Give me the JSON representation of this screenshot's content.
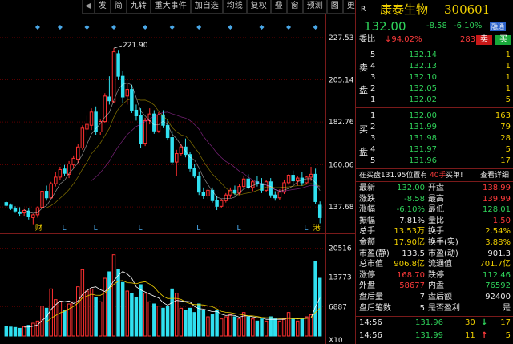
{
  "toolbar": {
    "items": [
      "发",
      "简",
      "九转",
      "重大事件",
      "加自选",
      "均线",
      "复权",
      "叠",
      "窗",
      "预测",
      "图",
      "更多"
    ],
    "arrow_left": "◀",
    "arrow_right": "▶"
  },
  "chart_data": {
    "type": "candlestick",
    "price_axis": {
      "ticks": [
        "227.53",
        "205.14",
        "182.76",
        "160.06",
        "137.68"
      ],
      "tick_values": [
        227.53,
        205.14,
        182.76,
        160.06,
        137.68
      ],
      "range": [
        127.5,
        236.0
      ]
    },
    "volume_axis": {
      "ticks": [
        "20516",
        "13773",
        "6887",
        "X10"
      ],
      "tick_values": [
        20516,
        13773,
        6887
      ],
      "range": [
        0,
        22500
      ]
    },
    "max_annotation": "221.90",
    "event_markers": [
      "财",
      "L",
      "L",
      "L",
      "L",
      "L",
      "L",
      "港"
    ],
    "colors": {
      "up": "#ff3030",
      "down": "#30e0f0",
      "ma1": "#ffffff",
      "ma2": "#f0d000",
      "ma3": "#e040e0",
      "grid": "#5a0000",
      "axis_text": "#e8e8e8"
    },
    "candles": [
      [
        140,
        140.5,
        138,
        138.5
      ],
      [
        138.6,
        139.5,
        136,
        136.8
      ],
      [
        136.7,
        138,
        134.5,
        135.5
      ],
      [
        135,
        137.5,
        133,
        134.2
      ],
      [
        134.5,
        136.5,
        133,
        135.8
      ],
      [
        135.5,
        137,
        131,
        132.5
      ],
      [
        132,
        134,
        128.5,
        133.5
      ],
      [
        133.5,
        138,
        132,
        137.2
      ],
      [
        137.5,
        147,
        136,
        146
      ],
      [
        146,
        149,
        141,
        142.5
      ],
      [
        142.5,
        151,
        142,
        150
      ],
      [
        150,
        156,
        148.5,
        153.5
      ],
      [
        153.5,
        159,
        152,
        157.5
      ],
      [
        157.8,
        160,
        154,
        155.5
      ],
      [
        155,
        162,
        153,
        160.5
      ],
      [
        160,
        165,
        158.5,
        163.5
      ],
      [
        163,
        171,
        161,
        169.5
      ],
      [
        169,
        181,
        168,
        179.5
      ],
      [
        179,
        186,
        175,
        181.5
      ],
      [
        181,
        190,
        178.5,
        188
      ],
      [
        188,
        191,
        176,
        177.5
      ],
      [
        177.5,
        184,
        176,
        183
      ],
      [
        183,
        198,
        182,
        196.5
      ],
      [
        196,
        207,
        192,
        194
      ],
      [
        193.5,
        221.9,
        193,
        220
      ],
      [
        219,
        221,
        205,
        207
      ],
      [
        207,
        210,
        193,
        196
      ],
      [
        196.5,
        203,
        192,
        200
      ],
      [
        200,
        202.5,
        187.5,
        189
      ],
      [
        189,
        192,
        183.5,
        186
      ],
      [
        186,
        190,
        169,
        171.5
      ],
      [
        171.5,
        185,
        170,
        183.5
      ],
      [
        183.5,
        190,
        181.5,
        187
      ],
      [
        187,
        189,
        176.5,
        178
      ],
      [
        178,
        188,
        177,
        186.5
      ],
      [
        186.5,
        189,
        179.5,
        181
      ],
      [
        181,
        184,
        173,
        174.5
      ],
      [
        174.5,
        178,
        160,
        161.5
      ],
      [
        161.5,
        168,
        154,
        166
      ],
      [
        166,
        171,
        165,
        169.5
      ],
      [
        169.5,
        174,
        164,
        165.5
      ],
      [
        165.5,
        167,
        156.5,
        158
      ],
      [
        158,
        160.5,
        153,
        154
      ],
      [
        154,
        156.5,
        144,
        145.5
      ],
      [
        145.5,
        148,
        142,
        143.5
      ],
      [
        143.5,
        148,
        142,
        146.5
      ],
      [
        146.5,
        148,
        140,
        141
      ],
      [
        141,
        143.5,
        136,
        138
      ],
      [
        138,
        142,
        137,
        141
      ],
      [
        141,
        145,
        140,
        144
      ],
      [
        144,
        148,
        142.5,
        146.5
      ],
      [
        146.5,
        149,
        144,
        145
      ],
      [
        145,
        150,
        144,
        148.5
      ],
      [
        148.5,
        154,
        147.5,
        152.5
      ],
      [
        152.5,
        155,
        147,
        148
      ],
      [
        148,
        152,
        146,
        151
      ],
      [
        151,
        154,
        148.5,
        150
      ],
      [
        150,
        153,
        145,
        146.5
      ],
      [
        146.5,
        152,
        145.5,
        151
      ],
      [
        151,
        153,
        142.5,
        144
      ],
      [
        144,
        146,
        141,
        142.5
      ],
      [
        142.5,
        147,
        141.5,
        145.5
      ],
      [
        145.5,
        152,
        144.5,
        150.5
      ],
      [
        150.5,
        155,
        149.5,
        154.5
      ],
      [
        154.5,
        157,
        150,
        151.5
      ],
      [
        151.5,
        154,
        149,
        153
      ],
      [
        153,
        156,
        149,
        150.5
      ],
      [
        150.5,
        154,
        150,
        153.5
      ],
      [
        153.5,
        159,
        151.5,
        155
      ],
      [
        155,
        158,
        139,
        140.5
      ],
      [
        138.6,
        140.6,
        129,
        132
      ]
    ],
    "volumes": [
      2.3,
      2.1,
      2.0,
      1.8,
      2.2,
      2.5,
      3.0,
      3.5,
      7.0,
      6.5,
      11.0,
      8.5,
      8.0,
      6.0,
      7.5,
      8.0,
      11.5,
      15.5,
      10.5,
      11.0,
      9.0,
      8.0,
      13.5,
      15.0,
      19.0,
      15.5,
      12.5,
      10.5,
      10.0,
      9.0,
      12.0,
      10.0,
      8.0,
      7.5,
      7.0,
      6.5,
      7.0,
      11.0,
      10.0,
      6.5,
      6.0,
      6.5,
      5.5,
      7.5,
      6.0,
      4.5,
      5.0,
      6.0,
      4.0,
      4.5,
      5.0,
      4.5,
      4.0,
      5.5,
      4.5,
      4.0,
      3.5,
      4.0,
      3.5,
      4.5,
      4.0,
      3.5,
      4.0,
      5.5,
      4.0,
      3.5,
      4.0,
      4.5,
      5.0,
      17.5,
      13.5
    ],
    "event_marker_positions": [
      {
        "label": "财",
        "index": 7
      },
      {
        "label": "L",
        "index": 13
      },
      {
        "label": "L",
        "index": 20
      },
      {
        "label": "L",
        "index": 30
      },
      {
        "label": "L",
        "index": 43
      },
      {
        "label": "L",
        "index": 52
      },
      {
        "label": "L",
        "index": 67
      },
      {
        "label": "港",
        "index": 69
      }
    ],
    "diamond_indices": [
      7,
      12,
      18,
      24,
      31,
      37,
      43,
      50,
      57,
      63,
      69
    ]
  },
  "panel": {
    "flag": "R",
    "name": "康泰生物",
    "code": "300601",
    "price": "132.00",
    "change": "-8.58",
    "change_pct": "-6.10%",
    "tag": "融通",
    "weibi_label": "委比",
    "weibi_value": "↓94.02%",
    "weibi_num": "283",
    "sell_btn": "卖",
    "buy_btn": "买",
    "sell_side_label": [
      "卖",
      "盘"
    ],
    "buy_side_label": [
      "买",
      "盘"
    ],
    "asks": [
      {
        "lvl": "5",
        "price": "132.14",
        "vol": "1"
      },
      {
        "lvl": "4",
        "price": "132.13",
        "vol": "1"
      },
      {
        "lvl": "3",
        "price": "132.10",
        "vol": "1"
      },
      {
        "lvl": "2",
        "price": "132.05",
        "vol": "1"
      },
      {
        "lvl": "1",
        "price": "132.02",
        "vol": "5"
      }
    ],
    "bids": [
      {
        "lvl": "1",
        "price": "132.00",
        "vol": "163"
      },
      {
        "lvl": "2",
        "price": "131.99",
        "vol": "79"
      },
      {
        "lvl": "3",
        "price": "131.98",
        "vol": "28"
      },
      {
        "lvl": "4",
        "price": "131.97",
        "vol": "5"
      },
      {
        "lvl": "5",
        "price": "131.96",
        "vol": "17"
      }
    ],
    "notice_a": "在买盘131.95位置有",
    "notice_b": "40手",
    "notice_c": "买单!",
    "notice_link": "查看详细",
    "stats": [
      {
        "l1": "最新",
        "v1": "132.00",
        "l2": "开盘",
        "v2": "138.99",
        "c1": "green",
        "c2": "red"
      },
      {
        "l1": "涨跌",
        "v1": "-8.58",
        "l2": "最高",
        "v2": "139.99",
        "c1": "green",
        "c2": "red"
      },
      {
        "l1": "涨幅",
        "v1": "-6.10%",
        "l2": "最低",
        "v2": "128.01",
        "c1": "green",
        "c2": "green"
      },
      {
        "l1": "振幅",
        "v1": "7.81%",
        "l2": "量比",
        "v2": "1.50",
        "c1": "white",
        "c2": "red"
      },
      {
        "l1": "总手",
        "v1": "13.53万",
        "l2": "换手",
        "v2": "2.54%",
        "c1": "yellow",
        "c2": "yellow"
      },
      {
        "l1": "金额",
        "v1": "17.90亿",
        "l2": "换手(实)",
        "v2": "3.88%",
        "c1": "yellow",
        "c2": "yellow"
      },
      {
        "l1": "市盈(静)",
        "v1": "133.5",
        "l2": "市盈(动)",
        "v2": "901.3",
        "c1": "white",
        "c2": "white"
      },
      {
        "l1": "总市值",
        "v1": "906.8亿",
        "l2": "流通值",
        "v2": "701.7亿",
        "c1": "yellow",
        "c2": "yellow"
      },
      {
        "l1": "涨停",
        "v1": "168.70",
        "l2": "跌停",
        "v2": "112.46",
        "c1": "red",
        "c2": "green"
      },
      {
        "l1": "外盘",
        "v1": "58677",
        "l2": "内盘",
        "v2": "76592",
        "c1": "red",
        "c2": "green"
      },
      {
        "l1": "盘后量",
        "v1": "7",
        "l2": "盘后额",
        "v2": "92400",
        "c1": "white",
        "c2": "white"
      },
      {
        "l1": "盘后笔数",
        "v1": "5",
        "l2": "是否盈利",
        "v2": "是",
        "c1": "white",
        "c2": "white"
      }
    ],
    "ticks": [
      {
        "time": "14:56",
        "price": "131.96",
        "vol": "30",
        "dir": "↓",
        "num": "17",
        "cp": "green",
        "cv": "green"
      },
      {
        "time": "14:56",
        "price": "131.99",
        "vol": "11",
        "dir": "↑",
        "num": "5",
        "cp": "green",
        "cv": "red"
      }
    ]
  }
}
